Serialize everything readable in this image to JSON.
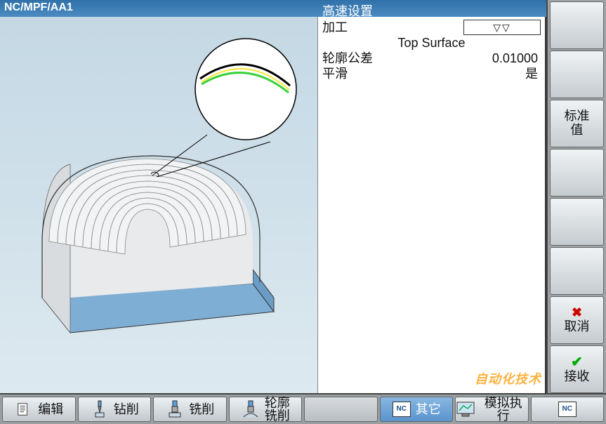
{
  "header": {
    "path": "NC/MPF/AA1",
    "panel_title": "高速设置"
  },
  "form": {
    "machining_label": "加工",
    "machining_value_symbol": "▽▽",
    "machining_mode": "Top Surface",
    "tolerance_label": "轮廓公差",
    "tolerance_value": "0.01000",
    "smooth_label": "平滑",
    "smooth_value": "是"
  },
  "right_softkeys": [
    {
      "id": "rk1",
      "label": ""
    },
    {
      "id": "rk2",
      "label": ""
    },
    {
      "id": "rk3",
      "label": "标准\n值"
    },
    {
      "id": "rk4",
      "label": ""
    },
    {
      "id": "rk5",
      "label": ""
    },
    {
      "id": "rk6",
      "label": ""
    },
    {
      "id": "rk7",
      "label": "取消",
      "mark": "x"
    },
    {
      "id": "rk8",
      "label": "接收",
      "mark": "check"
    }
  ],
  "bottom_softkeys": [
    {
      "id": "bk1",
      "label": "编辑",
      "icon": "edit"
    },
    {
      "id": "bk2",
      "label": "钻削",
      "icon": "drill"
    },
    {
      "id": "bk3",
      "label": "铣削",
      "icon": "mill"
    },
    {
      "id": "bk4",
      "label": "轮廓\n铣削",
      "icon": "contour"
    },
    {
      "id": "bk5",
      "label": "",
      "icon": ""
    },
    {
      "id": "bk6",
      "label": "其它",
      "icon": "nc",
      "active": true
    },
    {
      "id": "bk7",
      "label": "模拟执行",
      "icon": "sim"
    },
    {
      "id": "bk8",
      "label": "",
      "icon": "nc2"
    }
  ],
  "icons": {
    "edit": "edit-icon",
    "drill": "drill-icon",
    "mill": "mill-icon",
    "contour": "contour-mill-icon",
    "nc": "nc-icon",
    "sim": "simulation-icon"
  },
  "watermark": "自动化技术"
}
